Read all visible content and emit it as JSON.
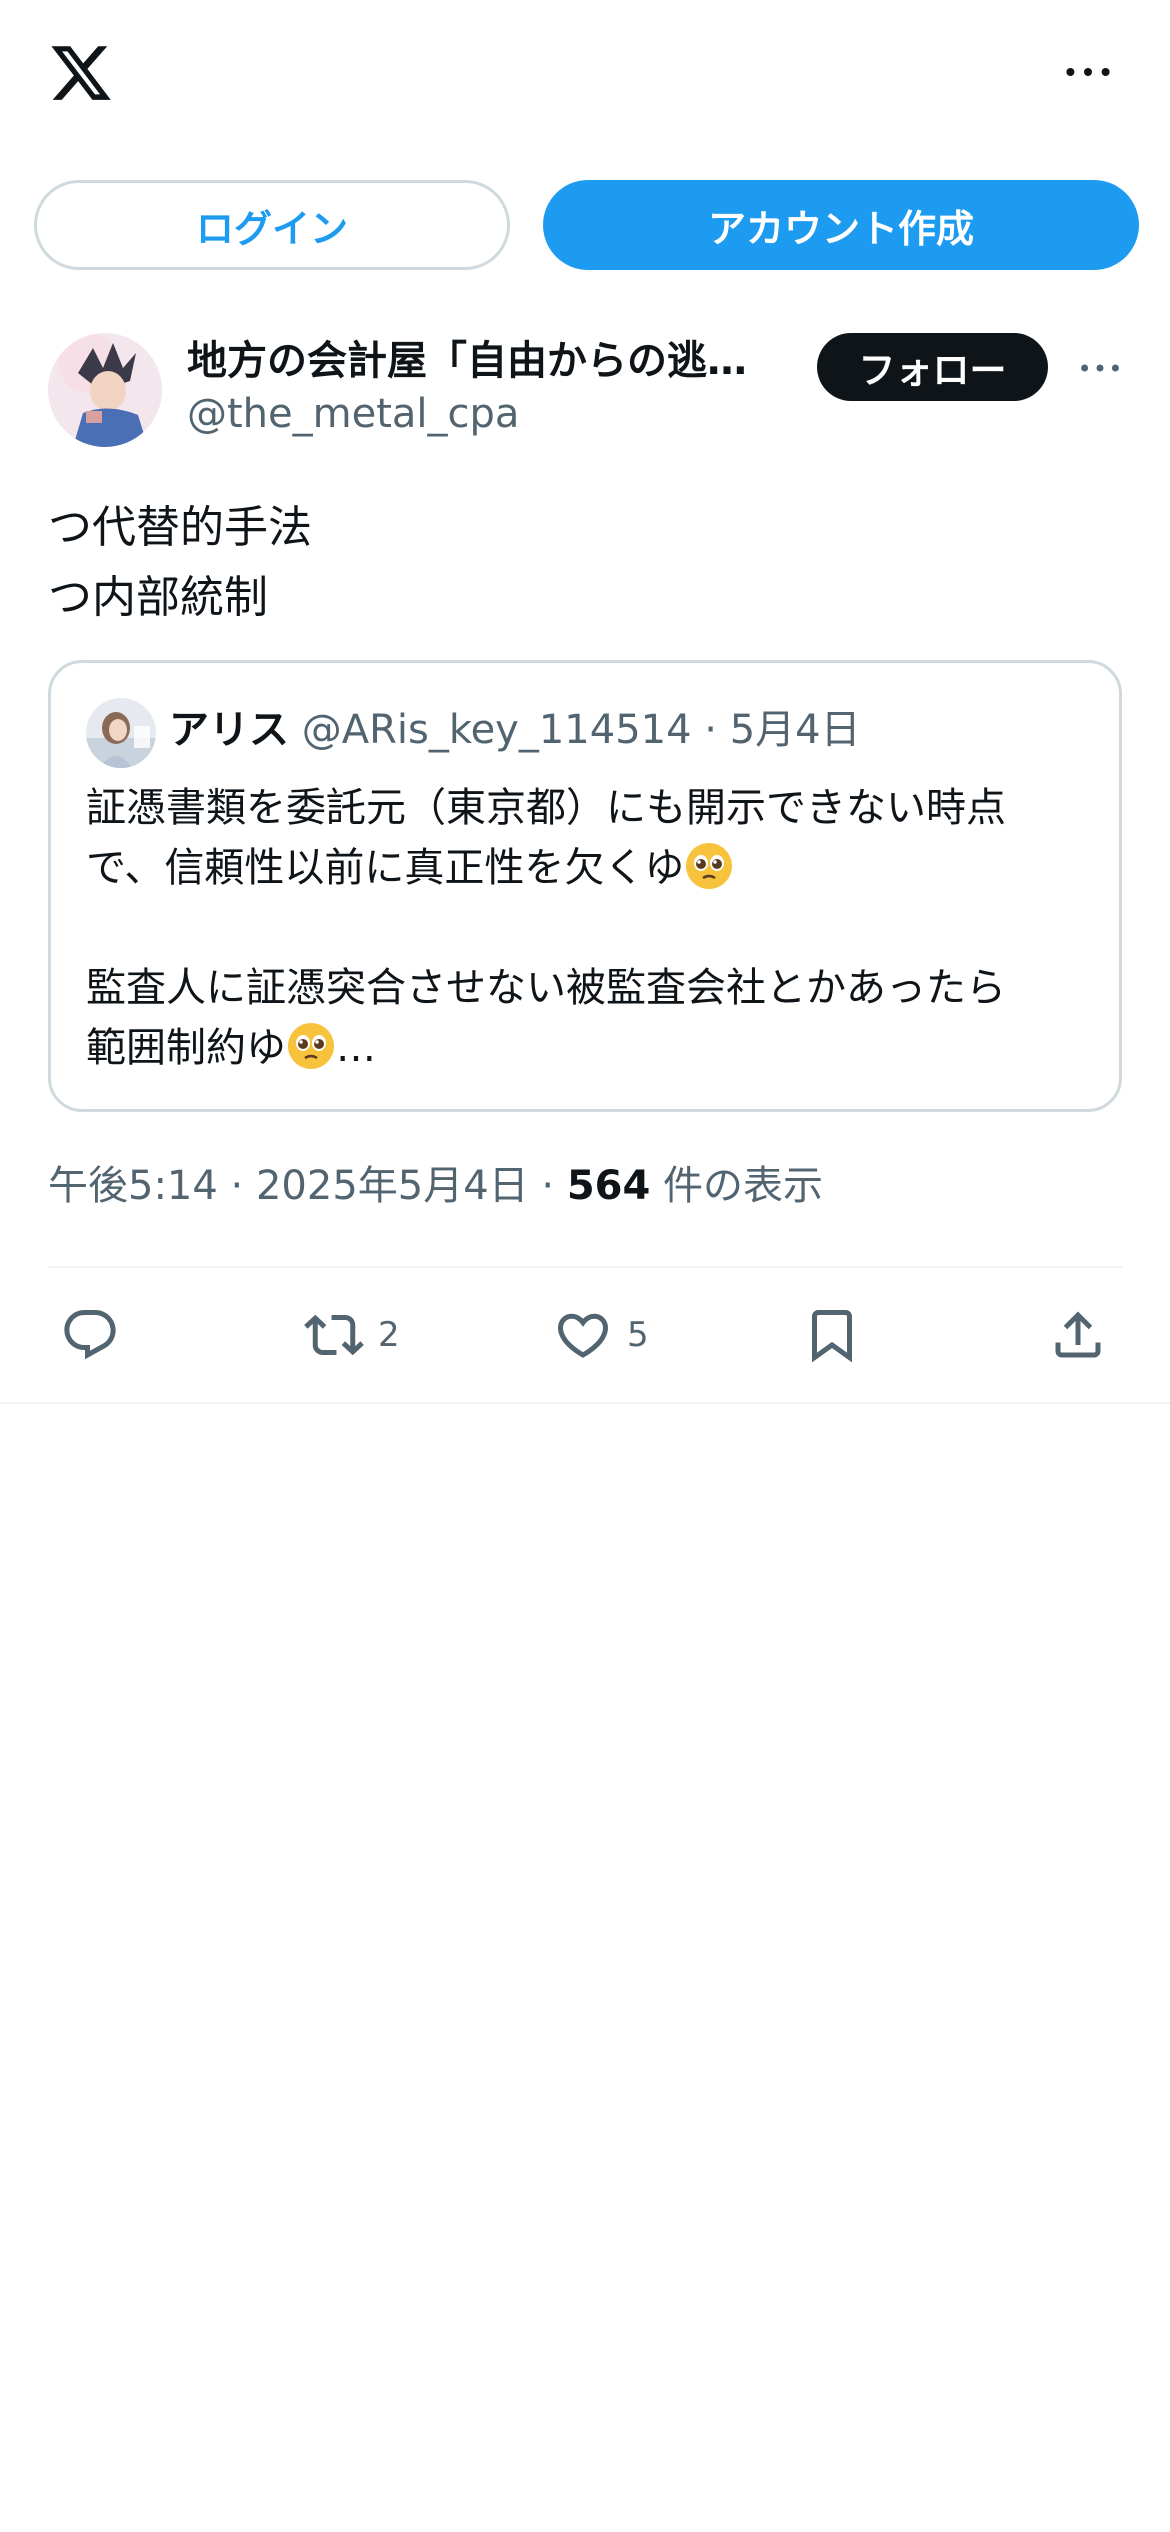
{
  "header": {
    "logo": "x-logo-icon",
    "more_icon": "more-horizontal-icon"
  },
  "auth": {
    "login_label": "ログイン",
    "signup_label": "アカウント作成"
  },
  "author": {
    "display_name": "地方の会計屋「自由からの逃…",
    "handle": "@the_metal_cpa",
    "follow_label": "フォロー"
  },
  "tweet": {
    "lines": [
      "つ代替的手法",
      "つ内部統制"
    ]
  },
  "quote": {
    "name": "アリス",
    "meta": "@ARis_key_114514 · 5月4日",
    "line1": "証憑書類を委託元（東京都）にも開示できない時点",
    "line2": "で、信頼性以前に真正性を欠くゆ",
    "line3": "監査人に証憑突合させない被監査会社とかあったら",
    "line4": "範囲制約ゆ",
    "ellipsis": "…"
  },
  "meta": {
    "time_date": "午後5:14 · 2025年5月4日 · ",
    "views_count": "564",
    "views_label": " 件の表示"
  },
  "actions": {
    "reply": {
      "icon": "reply-icon",
      "count": ""
    },
    "retweet": {
      "icon": "retweet-icon",
      "count": "2"
    },
    "like": {
      "icon": "heart-icon",
      "count": "5"
    },
    "bookmark": {
      "icon": "bookmark-icon",
      "count": ""
    },
    "share": {
      "icon": "share-icon",
      "count": ""
    }
  },
  "colors": {
    "accent": "#1d9bf0",
    "text": "#0f1419",
    "secondary": "#536471",
    "border": "#cfd9de"
  }
}
